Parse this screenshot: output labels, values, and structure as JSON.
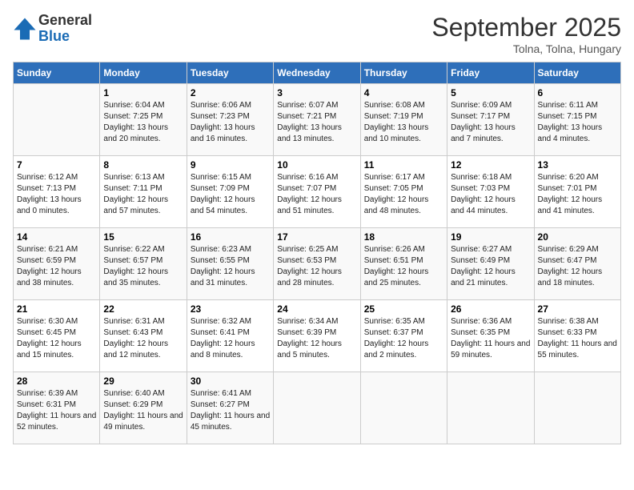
{
  "header": {
    "logo_general": "General",
    "logo_blue": "Blue",
    "month_title": "September 2025",
    "location": "Tolna, Tolna, Hungary"
  },
  "days_of_week": [
    "Sunday",
    "Monday",
    "Tuesday",
    "Wednesday",
    "Thursday",
    "Friday",
    "Saturday"
  ],
  "weeks": [
    [
      {
        "day": "",
        "sunrise": "",
        "sunset": "",
        "daylight": ""
      },
      {
        "day": "1",
        "sunrise": "6:04 AM",
        "sunset": "7:25 PM",
        "daylight": "13 hours and 20 minutes."
      },
      {
        "day": "2",
        "sunrise": "6:06 AM",
        "sunset": "7:23 PM",
        "daylight": "13 hours and 16 minutes."
      },
      {
        "day": "3",
        "sunrise": "6:07 AM",
        "sunset": "7:21 PM",
        "daylight": "13 hours and 13 minutes."
      },
      {
        "day": "4",
        "sunrise": "6:08 AM",
        "sunset": "7:19 PM",
        "daylight": "13 hours and 10 minutes."
      },
      {
        "day": "5",
        "sunrise": "6:09 AM",
        "sunset": "7:17 PM",
        "daylight": "13 hours and 7 minutes."
      },
      {
        "day": "6",
        "sunrise": "6:11 AM",
        "sunset": "7:15 PM",
        "daylight": "13 hours and 4 minutes."
      }
    ],
    [
      {
        "day": "7",
        "sunrise": "6:12 AM",
        "sunset": "7:13 PM",
        "daylight": "13 hours and 0 minutes."
      },
      {
        "day": "8",
        "sunrise": "6:13 AM",
        "sunset": "7:11 PM",
        "daylight": "12 hours and 57 minutes."
      },
      {
        "day": "9",
        "sunrise": "6:15 AM",
        "sunset": "7:09 PM",
        "daylight": "12 hours and 54 minutes."
      },
      {
        "day": "10",
        "sunrise": "6:16 AM",
        "sunset": "7:07 PM",
        "daylight": "12 hours and 51 minutes."
      },
      {
        "day": "11",
        "sunrise": "6:17 AM",
        "sunset": "7:05 PM",
        "daylight": "12 hours and 48 minutes."
      },
      {
        "day": "12",
        "sunrise": "6:18 AM",
        "sunset": "7:03 PM",
        "daylight": "12 hours and 44 minutes."
      },
      {
        "day": "13",
        "sunrise": "6:20 AM",
        "sunset": "7:01 PM",
        "daylight": "12 hours and 41 minutes."
      }
    ],
    [
      {
        "day": "14",
        "sunrise": "6:21 AM",
        "sunset": "6:59 PM",
        "daylight": "12 hours and 38 minutes."
      },
      {
        "day": "15",
        "sunrise": "6:22 AM",
        "sunset": "6:57 PM",
        "daylight": "12 hours and 35 minutes."
      },
      {
        "day": "16",
        "sunrise": "6:23 AM",
        "sunset": "6:55 PM",
        "daylight": "12 hours and 31 minutes."
      },
      {
        "day": "17",
        "sunrise": "6:25 AM",
        "sunset": "6:53 PM",
        "daylight": "12 hours and 28 minutes."
      },
      {
        "day": "18",
        "sunrise": "6:26 AM",
        "sunset": "6:51 PM",
        "daylight": "12 hours and 25 minutes."
      },
      {
        "day": "19",
        "sunrise": "6:27 AM",
        "sunset": "6:49 PM",
        "daylight": "12 hours and 21 minutes."
      },
      {
        "day": "20",
        "sunrise": "6:29 AM",
        "sunset": "6:47 PM",
        "daylight": "12 hours and 18 minutes."
      }
    ],
    [
      {
        "day": "21",
        "sunrise": "6:30 AM",
        "sunset": "6:45 PM",
        "daylight": "12 hours and 15 minutes."
      },
      {
        "day": "22",
        "sunrise": "6:31 AM",
        "sunset": "6:43 PM",
        "daylight": "12 hours and 12 minutes."
      },
      {
        "day": "23",
        "sunrise": "6:32 AM",
        "sunset": "6:41 PM",
        "daylight": "12 hours and 8 minutes."
      },
      {
        "day": "24",
        "sunrise": "6:34 AM",
        "sunset": "6:39 PM",
        "daylight": "12 hours and 5 minutes."
      },
      {
        "day": "25",
        "sunrise": "6:35 AM",
        "sunset": "6:37 PM",
        "daylight": "12 hours and 2 minutes."
      },
      {
        "day": "26",
        "sunrise": "6:36 AM",
        "sunset": "6:35 PM",
        "daylight": "11 hours and 59 minutes."
      },
      {
        "day": "27",
        "sunrise": "6:38 AM",
        "sunset": "6:33 PM",
        "daylight": "11 hours and 55 minutes."
      }
    ],
    [
      {
        "day": "28",
        "sunrise": "6:39 AM",
        "sunset": "6:31 PM",
        "daylight": "11 hours and 52 minutes."
      },
      {
        "day": "29",
        "sunrise": "6:40 AM",
        "sunset": "6:29 PM",
        "daylight": "11 hours and 49 minutes."
      },
      {
        "day": "30",
        "sunrise": "6:41 AM",
        "sunset": "6:27 PM",
        "daylight": "11 hours and 45 minutes."
      },
      {
        "day": "",
        "sunrise": "",
        "sunset": "",
        "daylight": ""
      },
      {
        "day": "",
        "sunrise": "",
        "sunset": "",
        "daylight": ""
      },
      {
        "day": "",
        "sunrise": "",
        "sunset": "",
        "daylight": ""
      },
      {
        "day": "",
        "sunrise": "",
        "sunset": "",
        "daylight": ""
      }
    ]
  ],
  "labels": {
    "sunrise_prefix": "Sunrise: ",
    "sunset_prefix": "Sunset: ",
    "daylight_prefix": "Daylight: "
  }
}
